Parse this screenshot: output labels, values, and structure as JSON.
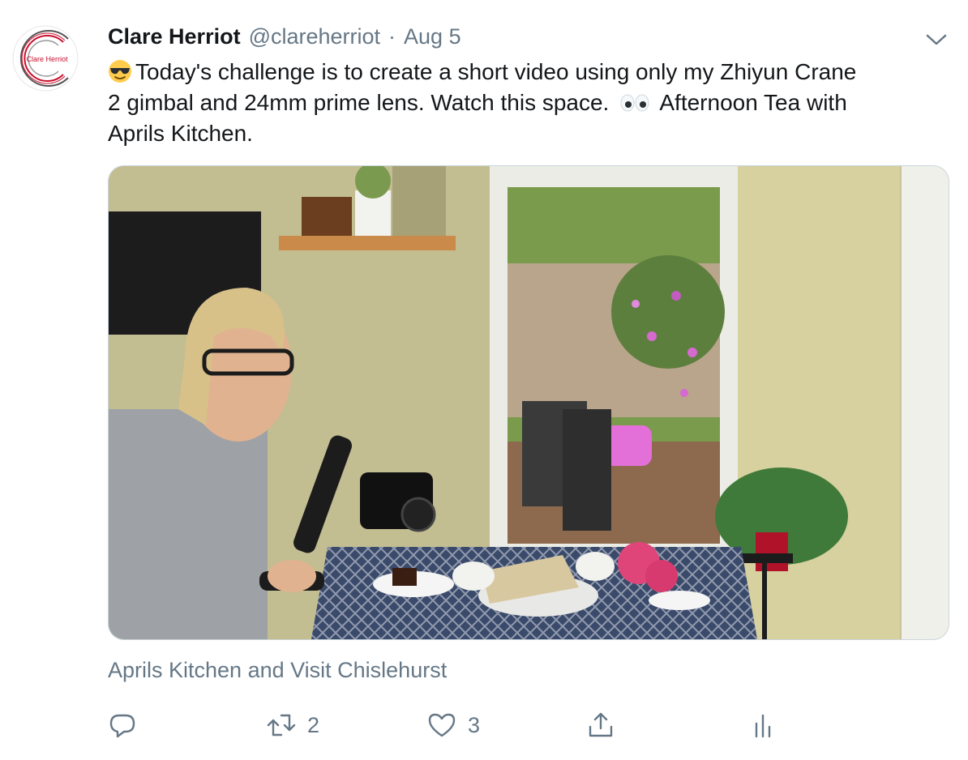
{
  "tweet": {
    "author": {
      "name": "Clare Herriot",
      "handle": "@clareherriot",
      "avatar_text": "Clare Herriot"
    },
    "separator": "·",
    "date": "Aug 5",
    "text_line1": "Today's challenge is to create a short video using only my Zhiyun Crane",
    "text_line2": "2 gimbal and 24mm prime lens. Watch this space.",
    "text_line2_end": "Afternoon Tea with",
    "text_line3": "Aprils Kitchen.",
    "emoji_start": "smiling-face-with-sunglasses",
    "emoji_mid": "eyes",
    "media_caption": "Aprils Kitchen and Visit Chislehurst",
    "media_description_icon": "photo-kitchen-gimbal",
    "actions": {
      "reply_icon": "reply-icon",
      "retweet_count": "2",
      "like_count": "3",
      "share_icon": "share-icon",
      "analytics_icon": "analytics-icon"
    }
  },
  "colors": {
    "text": "#14171a",
    "secondary": "#657786",
    "border": "#ccd6dd",
    "avatar_red": "#c8102e"
  }
}
